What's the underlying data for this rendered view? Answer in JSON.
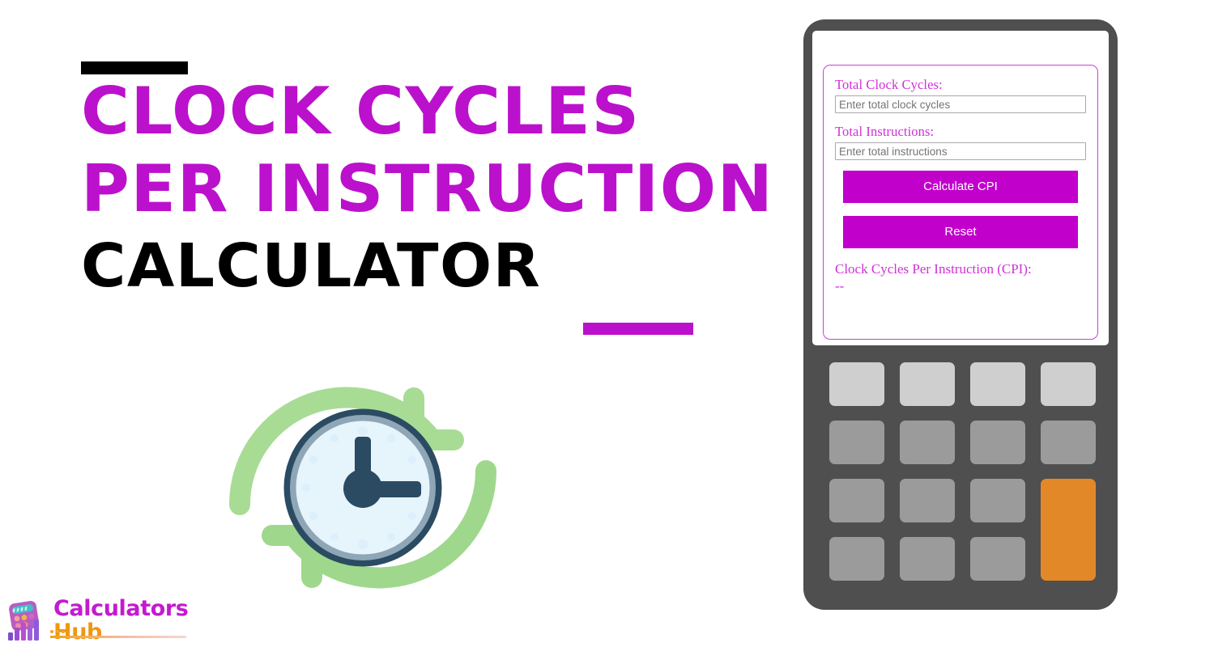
{
  "hero": {
    "title_line1": "CLOCK CYCLES",
    "title_line2": "PER INSTRUCTION",
    "title_line3": "CALCULATOR",
    "accent_color": "#bb11cc",
    "black_color": "#000000"
  },
  "logo": {
    "brand_line1": "Calculators",
    "brand_line2": "Hub",
    "brand_color_1": "#c31ad0",
    "brand_color_2": "#f0960f"
  },
  "illustration": {
    "name": "clock-with-refresh-arrows",
    "clock_outline_color": "#2b4b63",
    "clock_face_color": "#eaf6fd",
    "arrow_color": "#a8dc95"
  },
  "calculator": {
    "body_color": "#4f4f4f",
    "screen_color": "#ffffff",
    "form": {
      "border_color": "#cf3ddc",
      "fields": [
        {
          "label": "Total Clock Cycles:",
          "placeholder": "Enter total clock cycles",
          "value": ""
        },
        {
          "label": "Total Instructions:",
          "placeholder": "Enter total instructions",
          "value": ""
        }
      ],
      "buttons": {
        "calculate": "Calculate CPI",
        "reset": "Reset",
        "color": "#c200cc"
      },
      "result": {
        "label": "Clock Cycles Per Instruction (CPI):",
        "value": "--"
      }
    },
    "keypad": {
      "rows": 4,
      "columns": 4,
      "light_key_color": "#cfcfcf",
      "mid_key_color": "#9b9b9b",
      "accent_key_color": "#e28828"
    }
  }
}
